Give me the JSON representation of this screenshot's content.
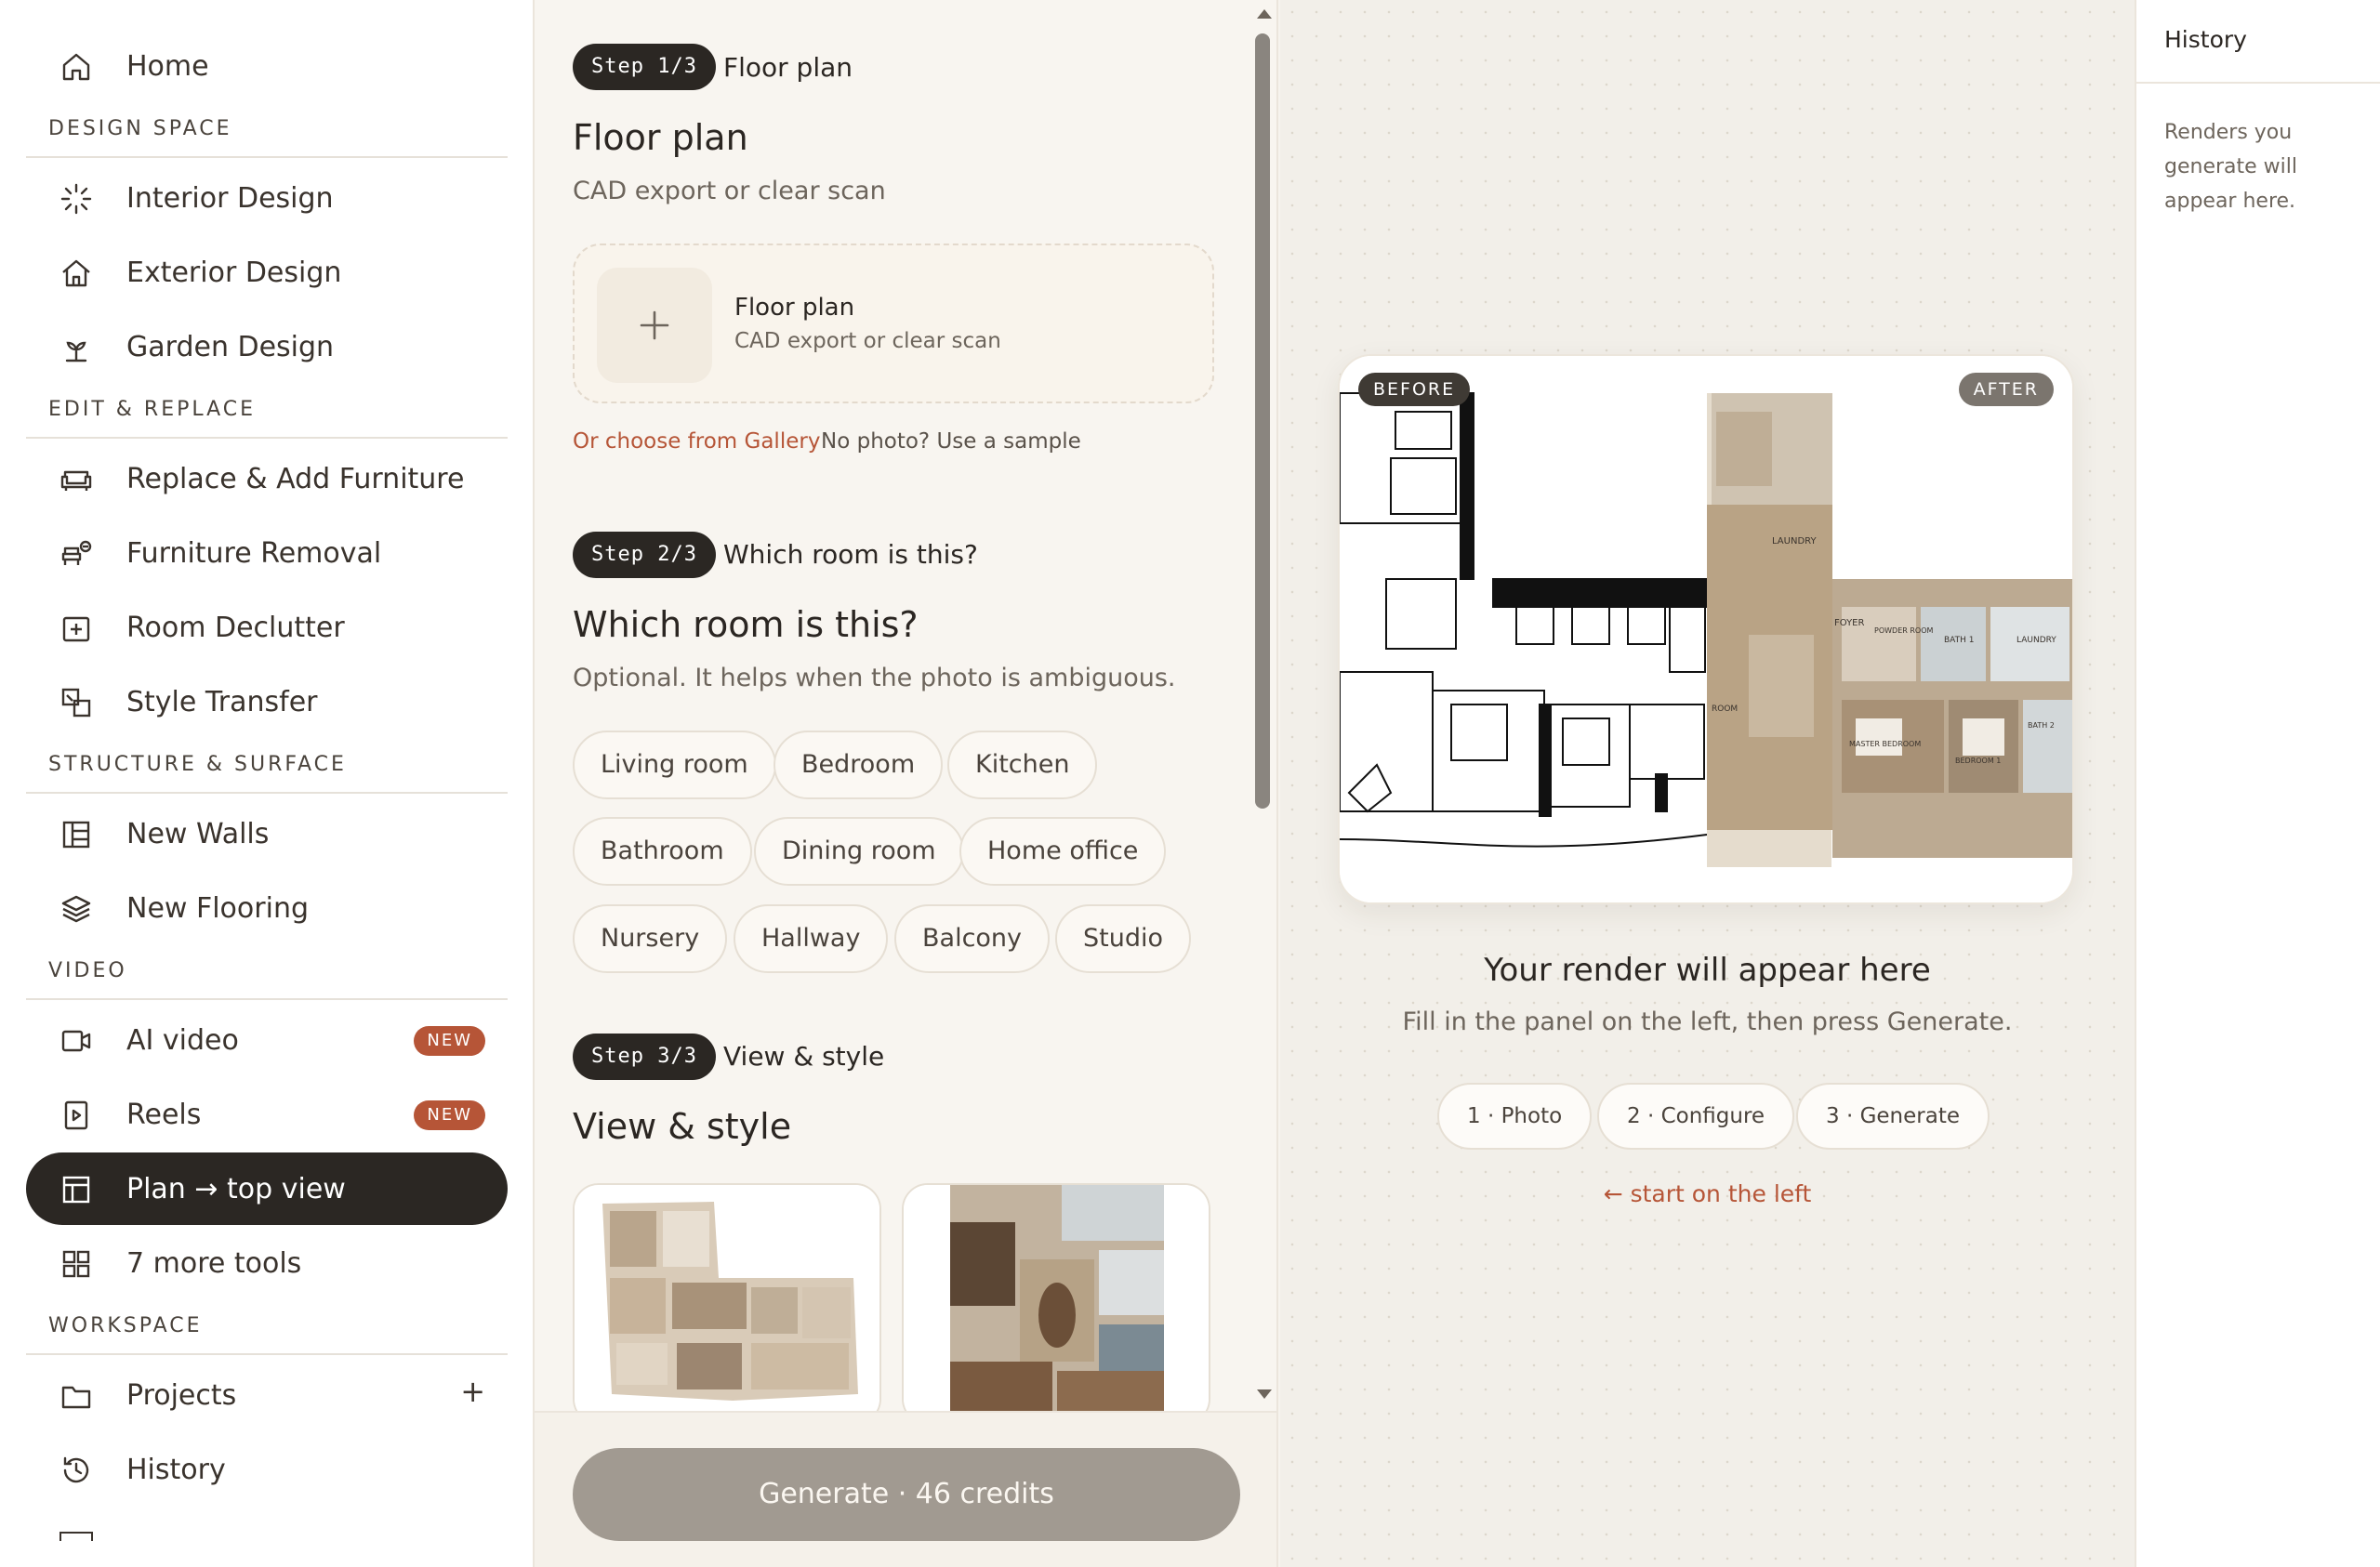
{
  "sidebar": {
    "home": "Home",
    "sections": {
      "design_space": "DESIGN SPACE",
      "edit_replace": "EDIT & REPLACE",
      "structure_surface": "STRUCTURE & SURFACE",
      "video": "VIDEO",
      "workspace": "WORKSPACE"
    },
    "items": {
      "interior": "Interior Design",
      "exterior": "Exterior Design",
      "garden": "Garden Design",
      "replace_furniture": "Replace & Add Furniture",
      "furniture_removal": "Furniture Removal",
      "room_declutter": "Room Declutter",
      "style_transfer": "Style Transfer",
      "new_walls": "New Walls",
      "new_flooring": "New Flooring",
      "ai_video": "AI video",
      "reels": "Reels",
      "plan_top_view": "Plan → top view",
      "more_tools": "7 more tools",
      "projects": "Projects",
      "history": "History"
    },
    "badge_new": "NEW",
    "projects_add": "+"
  },
  "panel": {
    "step1": {
      "pill": "Step 1/3",
      "title": "Floor plan",
      "heading": "Floor plan",
      "sub": "CAD export or clear scan",
      "upload_title": "Floor plan",
      "upload_sub": "CAD export or clear scan",
      "gallery_link": "Or choose from Gallery",
      "sample_link": "No photo? Use a sample"
    },
    "step2": {
      "pill": "Step 2/3",
      "title": "Which room is this?",
      "heading": "Which room is this?",
      "sub": "Optional. It helps when the photo is ambiguous.",
      "rooms": [
        "Living room",
        "Bedroom",
        "Kitchen",
        "Bathroom",
        "Dining room",
        "Home office",
        "Nursery",
        "Hallway",
        "Balcony",
        "Studio"
      ]
    },
    "step3": {
      "pill": "Step 3/3",
      "title": "View & style",
      "heading": "View & style"
    },
    "generate_label": "Generate · 46 credits"
  },
  "preview": {
    "before_tag": "BEFORE",
    "after_tag": "AFTER",
    "title": "Your render will appear here",
    "sub": "Fill in the panel on the left, then press Generate.",
    "steps": [
      "1 · Photo",
      "2 · Configure",
      "3 · Generate"
    ],
    "start_link": "← start on the left",
    "plan_labels": [
      "LAUNDRY",
      "FOYER",
      "POWDER ROOM",
      "BATH 1",
      "LAUNDRY",
      "ROOM",
      "MASTER BEDROOM",
      "BEDROOM 1",
      "BATH 2"
    ]
  },
  "history": {
    "title": "History",
    "empty": "Renders you generate will appear here."
  },
  "colors": {
    "accent": "#b65537",
    "dark": "#2b2723",
    "button_disabled": "#a19a91"
  }
}
